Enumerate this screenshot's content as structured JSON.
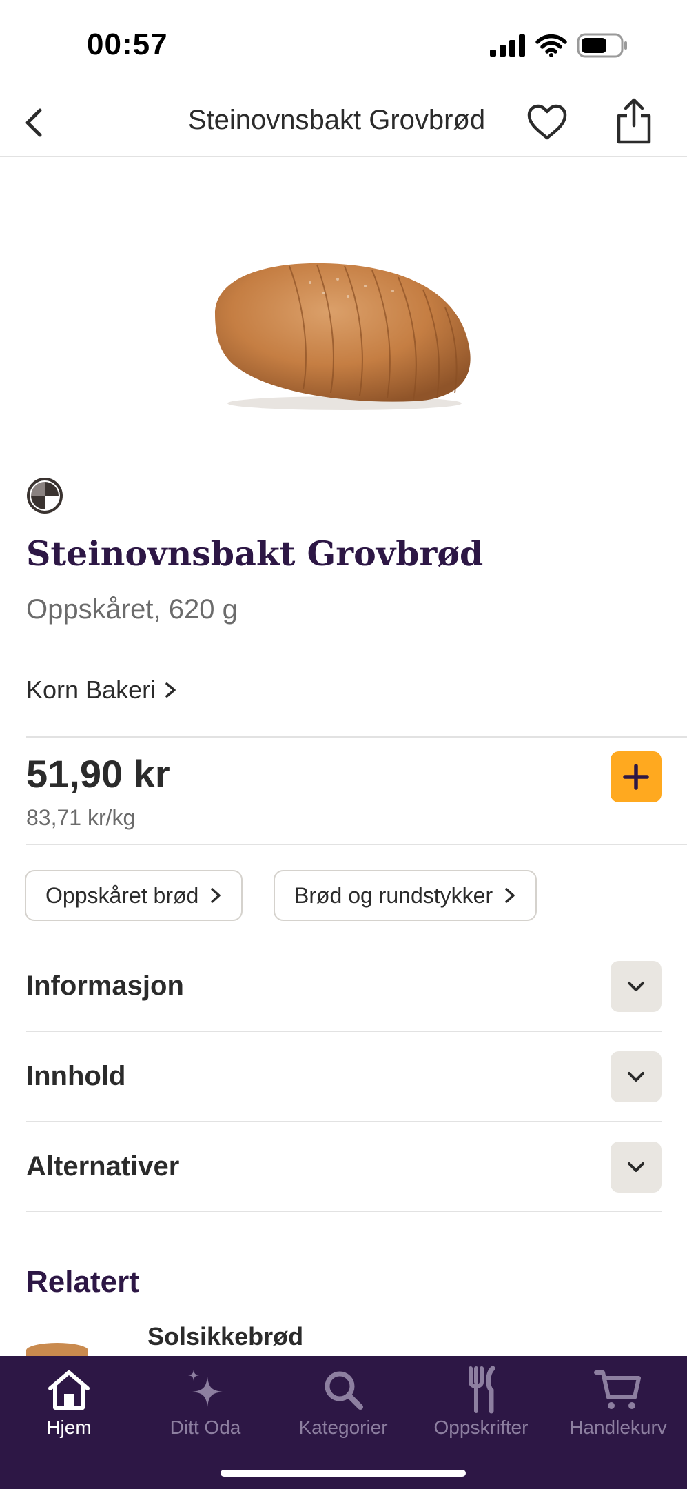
{
  "status_bar": {
    "time": "00:57"
  },
  "nav": {
    "title": "Steinovnsbakt Grovbrød"
  },
  "product": {
    "title": "Steinovnsbakt Grovbrød",
    "subtitle": "Oppskåret, 620 g",
    "producer": "Korn Bakeri",
    "price": "51,90 kr",
    "unit_price": "83,71 kr/kg"
  },
  "chips": [
    {
      "label": "Oppskåret brød"
    },
    {
      "label": "Brød og rundstykker"
    }
  ],
  "accordions": [
    {
      "label": "Informasjon"
    },
    {
      "label": "Innhold"
    },
    {
      "label": "Alternativer"
    }
  ],
  "related": {
    "title": "Relatert",
    "items": [
      {
        "name": "Solsikkebrød"
      }
    ]
  },
  "tabs": [
    {
      "label": "Hjem",
      "icon": "home-icon",
      "active": true
    },
    {
      "label": "Ditt Oda",
      "icon": "sparkle-icon",
      "active": false
    },
    {
      "label": "Kategorier",
      "icon": "search-icon",
      "active": false
    },
    {
      "label": "Oppskrifter",
      "icon": "fork-knife-icon",
      "active": false
    },
    {
      "label": "Handlekurv",
      "icon": "cart-icon",
      "active": false
    }
  ],
  "colors": {
    "brand_purple": "#2d1745",
    "accent_orange": "#ffa91f",
    "toggle_bg": "#e9e6e1",
    "inactive_tab": "#8d7fa0"
  }
}
